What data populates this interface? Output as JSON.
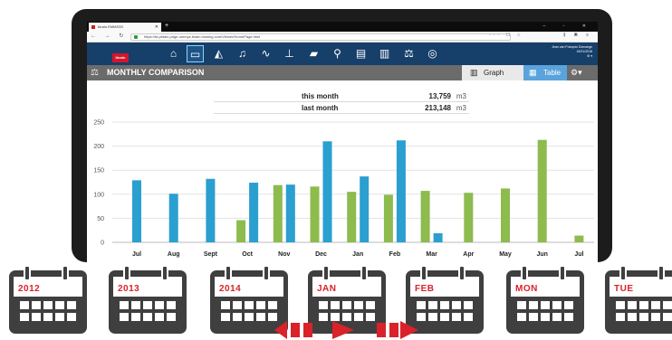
{
  "browser": {
    "tab_title": "Ibrain EMMS3S",
    "url": "https://fa.pbtalo.prige-ommys.ibrain.hosting.com/Viewer/HomePage.html",
    "window_controls": "– ▫ ✕"
  },
  "app": {
    "logo_text": "Ibrain",
    "user_name": "Jean van François Domange",
    "date": "15/01/2018",
    "nav_icons": [
      "home-icon",
      "dashboard-icon",
      "area-chart-icon",
      "bell-icon",
      "pulse-icon",
      "hierarchy-icon",
      "folder-icon",
      "map-pin-icon",
      "report-icon",
      "document-icon",
      "balance-icon",
      "leaf-icon"
    ]
  },
  "panel": {
    "title": "MONTHLY COMPARISON",
    "graph_tab": "Graph",
    "table_tab": "Table"
  },
  "summary": [
    {
      "label": "this month",
      "value": "13,759",
      "unit": "m3"
    },
    {
      "label": "last month",
      "value": "213,148",
      "unit": "m3"
    }
  ],
  "chart_data": {
    "type": "bar",
    "categories": [
      "Jul",
      "Aug",
      "Sept",
      "Oct",
      "Nov",
      "Dec",
      "Jan",
      "Feb",
      "Mar",
      "Apr",
      "May",
      "Jun",
      "Jul"
    ],
    "series": [
      {
        "color": "#8dbb4e",
        "values": [
          null,
          null,
          null,
          46,
          119,
          116,
          105,
          99,
          107,
          103,
          112,
          213,
          14
        ]
      },
      {
        "color": "#2a9fd0",
        "values": [
          129,
          101,
          132,
          124,
          120,
          210,
          137,
          212,
          19,
          null,
          null,
          null,
          null
        ]
      }
    ],
    "ylim": [
      0,
      250
    ],
    "yticks": [
      0,
      50,
      100,
      150,
      200,
      250
    ],
    "grid": true
  },
  "calendars": [
    "2012",
    "2013",
    "2014",
    "JAN",
    "FEB",
    "MON",
    "TUE"
  ],
  "colors": {
    "accent_red": "#d9222a",
    "nav_blue": "#163f6a",
    "table_tab": "#5aa3dc"
  }
}
